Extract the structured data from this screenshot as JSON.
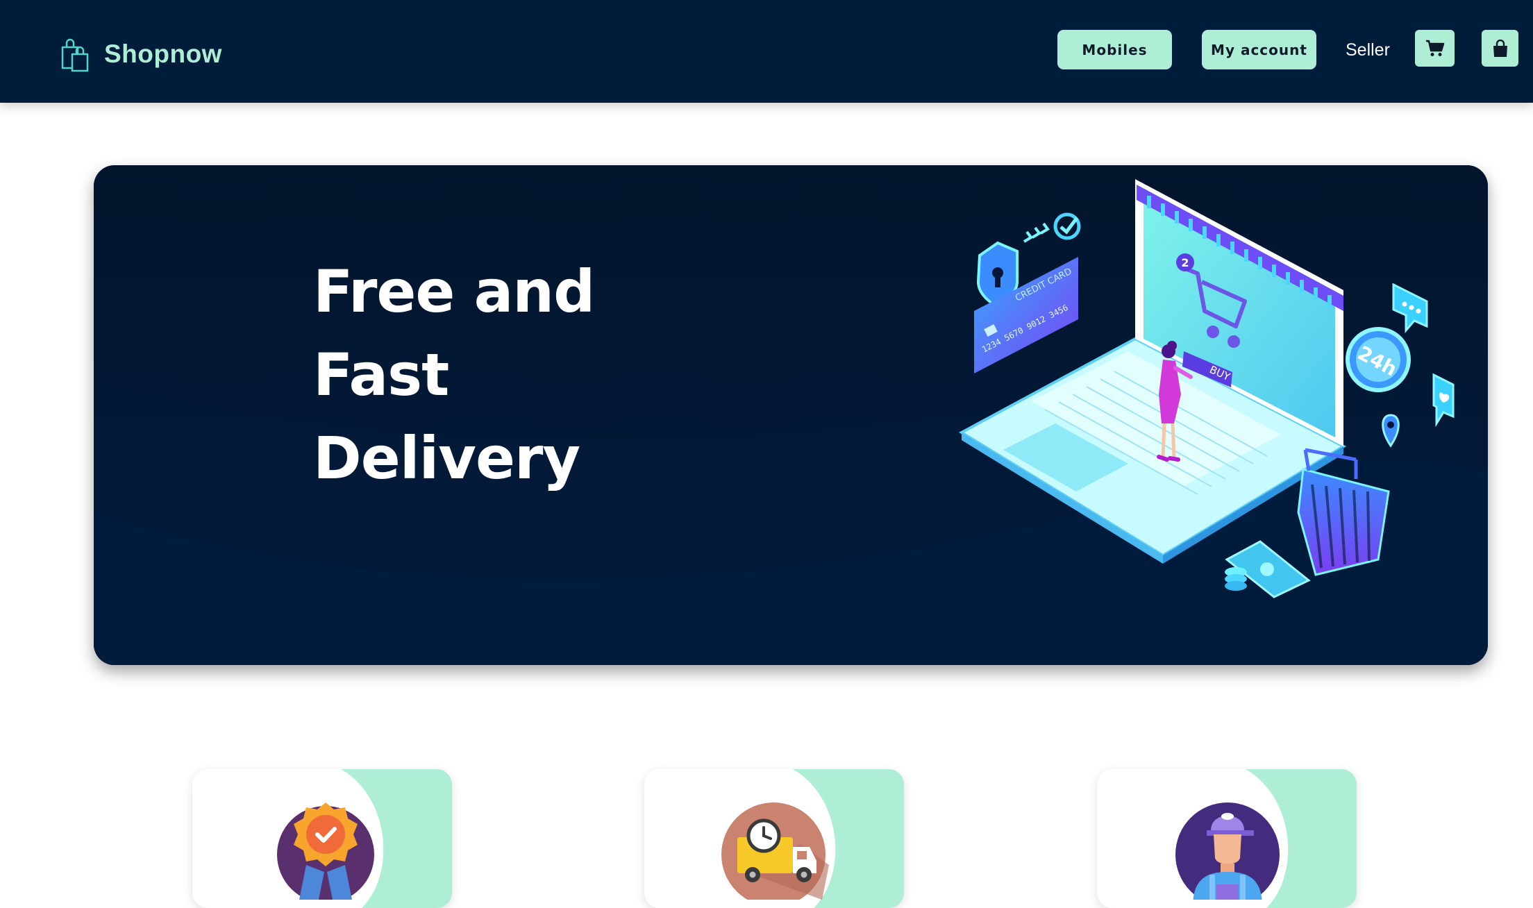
{
  "brand": {
    "name": "Shopnow",
    "color": "#aeeed4"
  },
  "nav": {
    "mobiles_label": "Mobiles",
    "account_label": "My account",
    "seller_label": "Seller",
    "cart_icon": "cart-icon",
    "bag_icon": "bag-icon"
  },
  "hero": {
    "title_lines": [
      "Free and",
      "Fast",
      "Delivery"
    ],
    "illustration_text": {
      "card_title": "CREDIT CARD",
      "card_number": "1234 5670 9012 3456",
      "buy_label": "BUY",
      "cart_count": "2",
      "support_label": "24h"
    }
  },
  "features": [
    {
      "icon": "award-badge-icon"
    },
    {
      "icon": "delivery-truck-icon"
    },
    {
      "icon": "delivery-person-icon"
    }
  ],
  "colors": {
    "navbar_bg": "#001c3b",
    "accent": "#aeeed4",
    "hero_bg": "#03152d"
  }
}
